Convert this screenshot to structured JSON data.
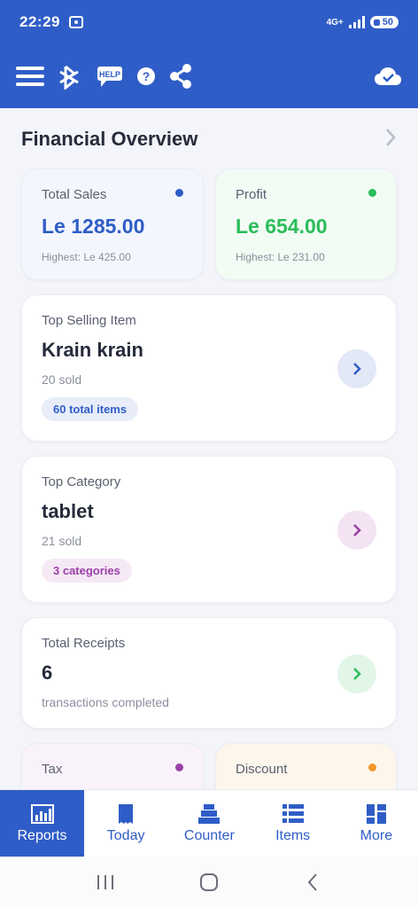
{
  "status_bar": {
    "time": "22:29",
    "network": "4G+",
    "battery": "50"
  },
  "header": {
    "icons": [
      "menu-icon",
      "bluetooth-printer-icon",
      "help-icon",
      "question-icon",
      "share-icon",
      "cloud-sync-icon"
    ],
    "help_badge": "HELP"
  },
  "overview": {
    "title": "Financial Overview"
  },
  "total_sales": {
    "label": "Total Sales",
    "value": "Le 1285.00",
    "highest": "Highest: Le 425.00",
    "dot_color": "#2f5dc7"
  },
  "profit": {
    "label": "Profit",
    "value": "Le 654.00",
    "highest": "Highest: Le 231.00",
    "dot_color": "#2bbd5a"
  },
  "top_item": {
    "label": "Top Selling Item",
    "name": "Krain krain",
    "sold": "20 sold",
    "badge": "60 total items"
  },
  "top_category": {
    "label": "Top Category",
    "name": "tablet",
    "sold": "21 sold",
    "badge": "3 categories"
  },
  "receipts": {
    "label": "Total Receipts",
    "value": "6",
    "sub": "transactions completed"
  },
  "tax": {
    "label": "Tax",
    "dot_color": "#9b3fa6"
  },
  "discount": {
    "label": "Discount",
    "dot_color": "#f0982a"
  },
  "nav": {
    "reports": "Reports",
    "today": "Today",
    "counter": "Counter",
    "items": "Items",
    "more": "More"
  },
  "colors": {
    "primary": "#2f5dc7",
    "green": "#2bbd5a",
    "purple": "#9b3fa6",
    "orange": "#f0982a"
  }
}
